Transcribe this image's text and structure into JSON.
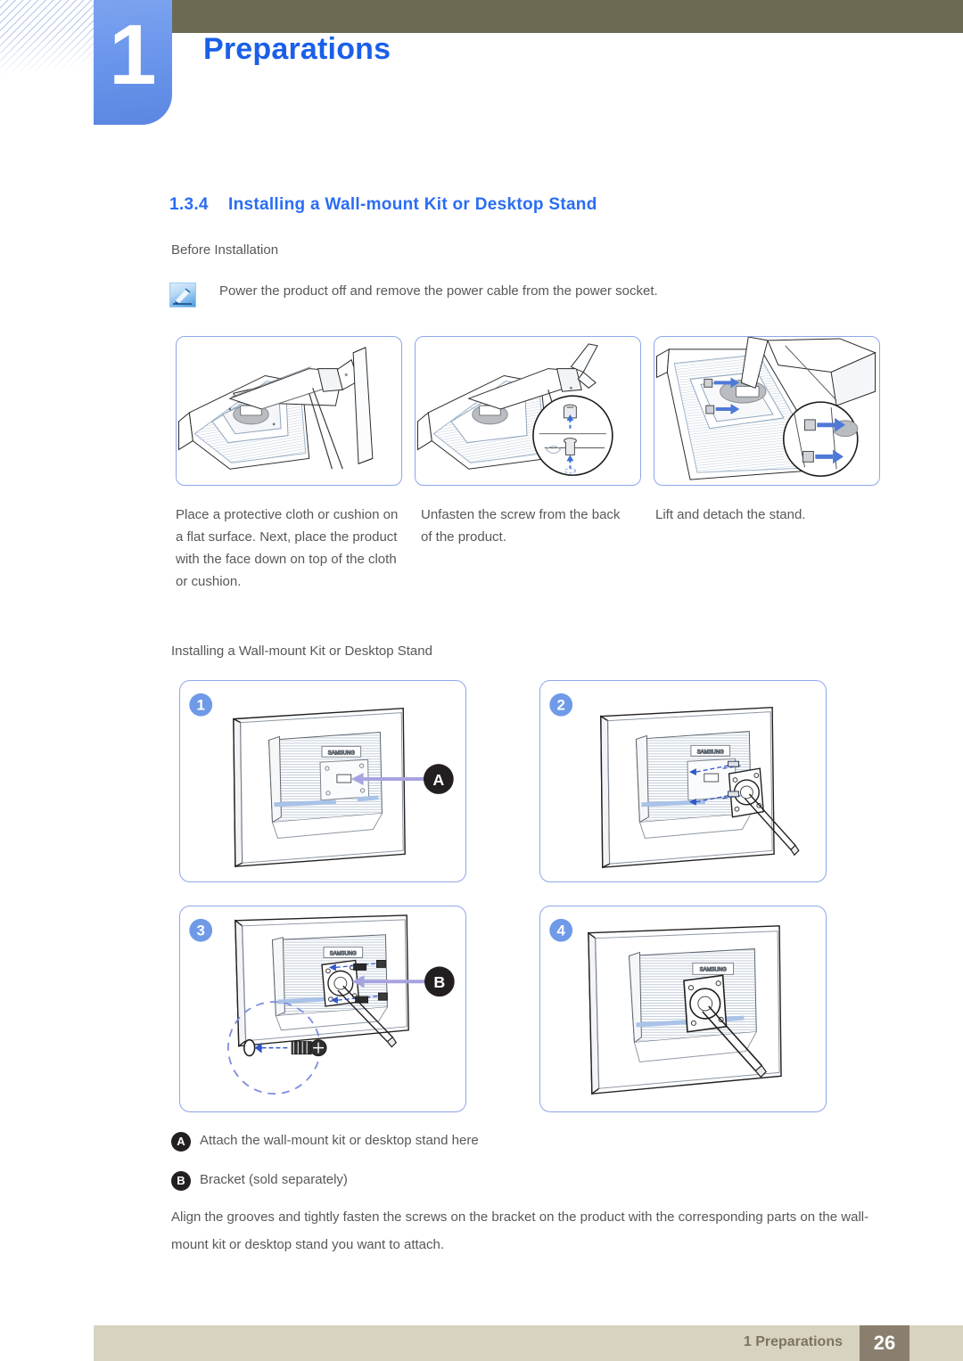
{
  "header": {
    "chapter_number": "1",
    "chapter_title": "Preparations",
    "accent_blue": "#1b5fe8",
    "tab_blue": "#6b96ec",
    "olive": "#6d6a54"
  },
  "section": {
    "number": "1.3.4",
    "title": "Installing a Wall-mount Kit or Desktop Stand",
    "before_installation": "Before Installation",
    "note": "Power the product off and remove the power cable from the power socket."
  },
  "top_figures": {
    "captions": [
      "Place a protective cloth or cushion on a flat surface. Next, place the product with the face down on top of the cloth or cushion.",
      "Unfasten the screw from the back of the product.",
      "Lift and detach the stand."
    ],
    "icon_names": [
      "monitor-face-down-illustration",
      "unfasten-screw-illustration",
      "lift-detach-stand-illustration"
    ]
  },
  "subsection": {
    "title": "Installing a Wall-mount Kit or Desktop Stand"
  },
  "steps": [
    {
      "number": "1",
      "label": "A",
      "alt": "monitor-back-mount-point-illustration"
    },
    {
      "number": "2",
      "label": "",
      "alt": "bracket-alignment-illustration"
    },
    {
      "number": "3",
      "label": "B",
      "alt": "bracket-screw-fasten-illustration"
    },
    {
      "number": "4",
      "label": "",
      "alt": "bracket-installed-illustration"
    }
  ],
  "legend": [
    {
      "badge": "A",
      "text": "Attach the wall-mount kit or desktop stand here"
    },
    {
      "badge": "B",
      "text": "Bracket (sold separately)"
    }
  ],
  "closing_paragraph": "Align the grooves and tightly fasten the screws on the bracket on the product with the corresponding parts on the wall-mount kit or desktop stand you want to attach.",
  "brand_on_monitor": "SAMSUNG",
  "footer": {
    "label": "1 Preparations",
    "page": "26",
    "bar_color": "#d8d3c0",
    "page_box_color": "#8a7f6e"
  }
}
